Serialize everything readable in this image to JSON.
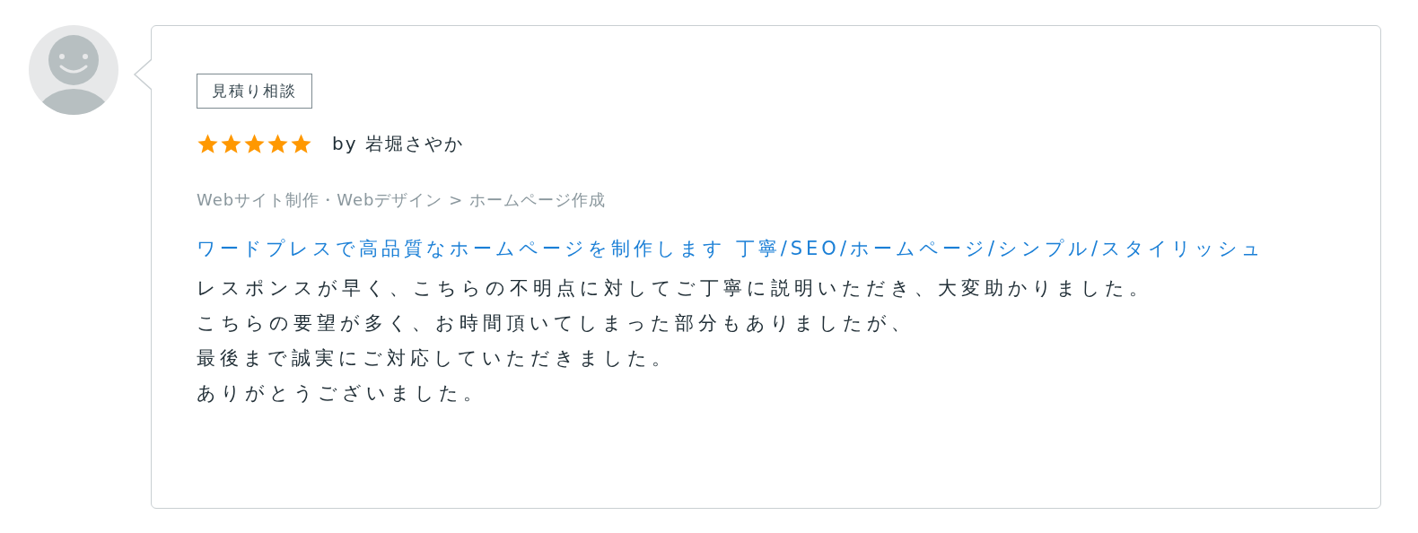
{
  "review": {
    "tag": "見積り相談",
    "stars": 5,
    "author": "by 岩堀さやか",
    "category": "Webサイト制作・Webデザイン > ホームページ作成",
    "service_link": "ワードプレスで高品質なホームページを制作します 丁寧/SEO/ホームページ/シンプル/スタイリッシュ",
    "body_lines": [
      "レスポンスが早く、こちらの不明点に対してご丁寧に説明いただき、大変助かりました。",
      "こちらの要望が多く、お時間頂いてしまった部分もありましたが、",
      "最後まで誠実にご対応していただきました。",
      "ありがとうございました。"
    ]
  }
}
